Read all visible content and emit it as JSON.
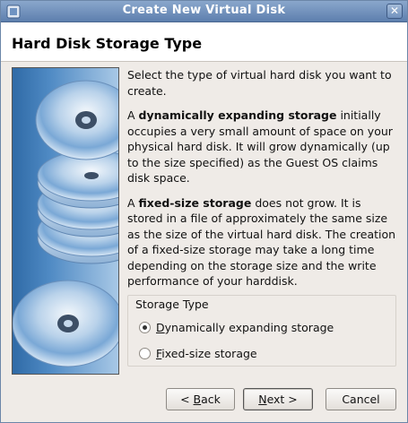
{
  "window": {
    "title": "Create New Virtual Disk",
    "close_glyph": "✕"
  },
  "header": {
    "title": "Hard Disk Storage Type"
  },
  "body": {
    "intro": "Select the type of virtual hard disk you want to create.",
    "dynamic_prefix": "A ",
    "dynamic_bold": "dynamically expanding storage",
    "dynamic_rest": " initially occupies a very small amount of space on your physical hard disk. It will grow dynamically (up to the size specified) as the Guest OS claims disk space.",
    "fixed_prefix": "A ",
    "fixed_bold": "fixed-size storage",
    "fixed_rest": " does not grow. It is stored in a file of approximately the same size as the size of the virtual hard disk. The creation of a fixed-size storage may take a long time depending on the storage size and the write performance of your harddisk."
  },
  "storage_type": {
    "label": "Storage Type",
    "options": [
      {
        "mnemonic": "D",
        "rest": "ynamically expanding storage",
        "selected": true
      },
      {
        "mnemonic": "F",
        "rest": "ixed-size storage",
        "selected": false
      }
    ]
  },
  "buttons": {
    "back_prefix": "< ",
    "back_mnemonic": "B",
    "back_rest": "ack",
    "next_mnemonic": "N",
    "next_rest": "ext >",
    "cancel": "Cancel"
  },
  "icons": {
    "window_icon": "virtualbox-icon",
    "banner": "disk-stack-image"
  }
}
